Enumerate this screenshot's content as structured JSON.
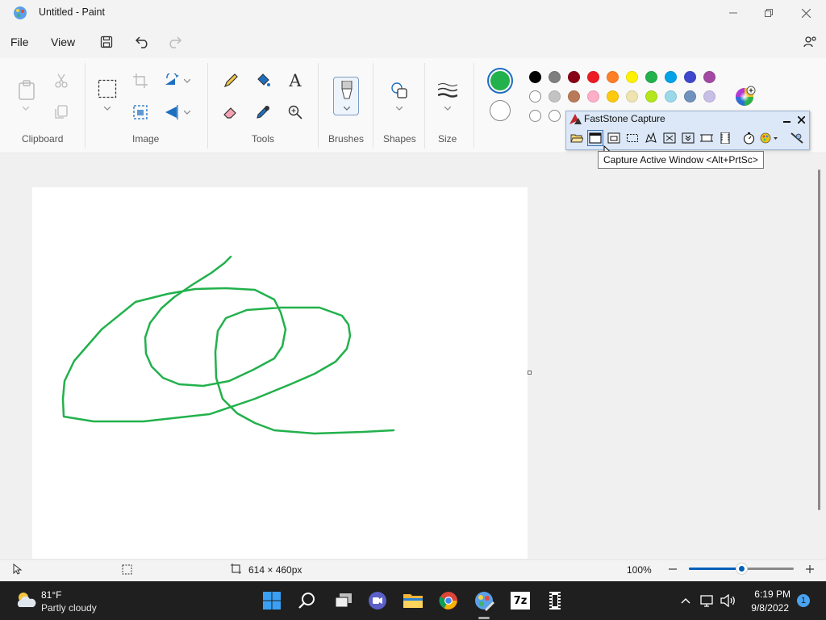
{
  "window": {
    "title": "Untitled - Paint"
  },
  "menu": {
    "file": "File",
    "view": "View"
  },
  "ribbon": {
    "groups": {
      "clipboard": "Clipboard",
      "image": "Image",
      "tools": "Tools",
      "brushes": "Brushes",
      "shapes": "Shapes",
      "size": "Size"
    },
    "tools": {
      "text_glyph": "A"
    },
    "colors": {
      "primary": "#22b14c",
      "secondary": "#ffffff",
      "palette_row1": [
        "#000000",
        "#7f7f7f",
        "#880015",
        "#ed1c24",
        "#ff7f27",
        "#fff200",
        "#22b14c",
        "#00a2e8",
        "#3f48cc",
        "#a349a4"
      ],
      "palette_row2": [
        "#ffffff",
        "#c3c3c3",
        "#b97a57",
        "#ffaec9",
        "#ffc90e",
        "#efe4b0",
        "#b5e61d",
        "#99d9ea",
        "#7092be",
        "#c8bfe7"
      ],
      "palette_row3": [
        "#ffffff",
        "#ffffff"
      ]
    }
  },
  "faststone": {
    "title": "FastStone Capture",
    "tooltip": "Capture Active Window <Alt+PrtSc>",
    "tools": [
      "open",
      "capture-active-window",
      "capture-window-object",
      "capture-rectangle",
      "capture-freehand",
      "capture-fullscreen",
      "capture-scrolling",
      "capture-fixed-region",
      "screen-recorder",
      "delay-timer",
      "color-picker",
      "settings"
    ]
  },
  "canvas": {
    "stroke_color": "#22b14c"
  },
  "status": {
    "canvas_size": "614 × 460px",
    "zoom": "100%",
    "zoom_percent": 100
  },
  "taskbar": {
    "temperature": "81°F",
    "weather": "Partly cloudy",
    "time": "6:19 PM",
    "date": "9/8/2022",
    "notification_count": "1",
    "archive_label": "7z"
  }
}
